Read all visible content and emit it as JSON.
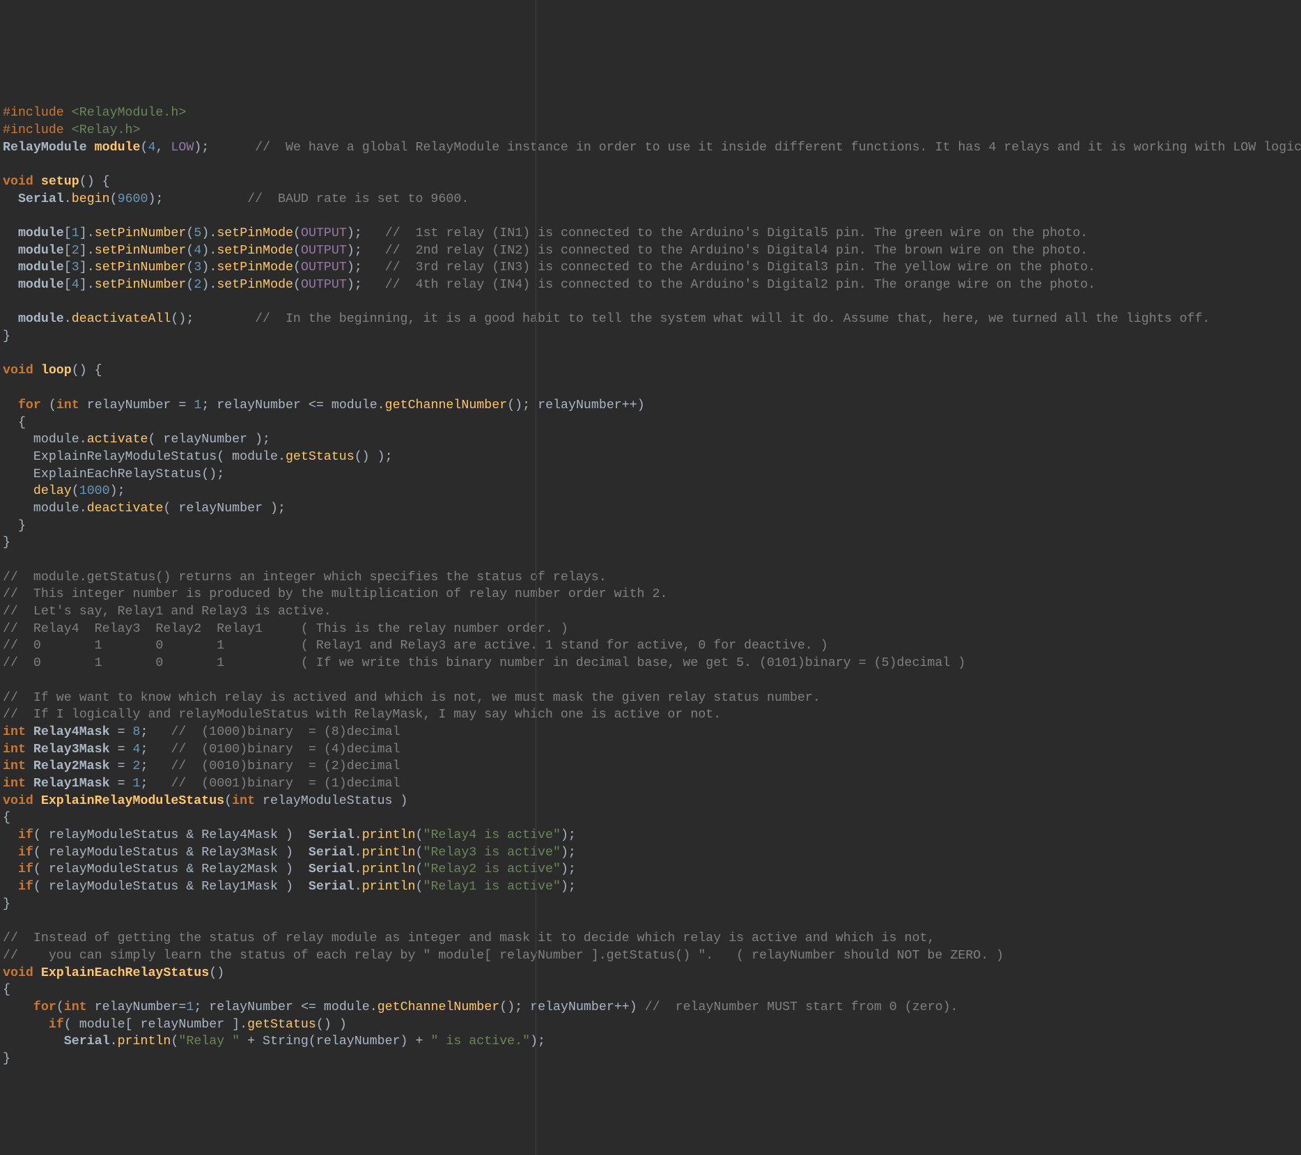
{
  "include1_kw": "#include ",
  "include1_hdr": "<RelayModule.h>",
  "include2_kw": "#include ",
  "include2_hdr": "<Relay.h>",
  "l3_type": "RelayModule ",
  "l3_var": "module",
  "l3_p1": "(",
  "l3_num1": "4",
  "l3_p2": ", ",
  "l3_const": "LOW",
  "l3_p3": ");",
  "l3_pad": "      ",
  "l3_cmt": "//  We have a global RelayModule instance in order to use it inside different functions. It has 4 relays and it is working with LOW logic.",
  "blank": " ",
  "setup_kw1": "void ",
  "setup_name": "setup",
  "setup_p": "() {",
  "ser_indent": "  ",
  "ser_obj": "Serial",
  "ser_dot": ".",
  "ser_fn": "begin",
  "ser_p1": "(",
  "ser_num": "9600",
  "ser_p2": ");",
  "ser_pad": "           ",
  "ser_cmt": "//  BAUD rate is set to 9600.",
  "pin_indent": "  ",
  "pin_obj": "module",
  "pin_lb": "[",
  "pin_rb": "]",
  "pin_dot": ".",
  "pin_fn1": "setPinNumber",
  "pin_fn2": "setPinMode",
  "pin_po": "(",
  "pin_pc": ")",
  "pin_sc": ";",
  "pin_out": "OUTPUT",
  "pin_pad": "   ",
  "pin1_idx": "1",
  "pin1_arg": "5",
  "pin1_cmt": "//  1st relay (IN1) is connected to the Arduino's Digital5 pin. The green wire on the photo.",
  "pin2_idx": "2",
  "pin2_arg": "4",
  "pin2_cmt": "//  2nd relay (IN2) is connected to the Arduino's Digital4 pin. The brown wire on the photo.",
  "pin3_idx": "3",
  "pin3_arg": "3",
  "pin3_cmt": "//  3rd relay (IN3) is connected to the Arduino's Digital3 pin. The yellow wire on the photo.",
  "pin4_idx": "4",
  "pin4_arg": "2",
  "pin4_cmt": "//  4th relay (IN4) is connected to the Arduino's Digital2 pin. The orange wire on the photo.",
  "deact_indent": "  ",
  "deact_obj": "module",
  "deact_dot": ".",
  "deact_fn": "deactivateAll",
  "deact_p": "();",
  "deact_pad": "        ",
  "deact_cmt": "//  In the beginning, it is a good habit to tell the system what will it do. Assume that, here, we turned all the lights off.",
  "cb": "}",
  "loop_kw": "void ",
  "loop_name": "loop",
  "loop_p": "() {",
  "for_indent": "  ",
  "for_kw": "for ",
  "for_po": "(",
  "for_int": "int ",
  "for_var": "relayNumber",
  "for_eq": " = ",
  "for_init": "1",
  "for_sc": "; ",
  "for_cond_v": "relayNumber",
  "for_cond_op": " <= ",
  "for_cond_obj": "module",
  "for_cond_dot": ".",
  "for_cond_fn": "getChannelNumber",
  "for_cond_p": "()",
  "for_sc2": "; ",
  "for_inc_v": "relayNumber",
  "for_inc_op": "++",
  "for_pc": ")",
  "ob": "  {",
  "b1_ind": "    ",
  "b1_obj": "module",
  "b1_dot": ".",
  "b1_fn": "activate",
  "b1_po": "( ",
  "b1_arg": "relayNumber",
  "b1_pc": " );",
  "b2_ind": "    ",
  "b2_fn": "ExplainRelayModuleStatus",
  "b2_po": "( ",
  "b2_obj": "module",
  "b2_dot": ".",
  "b2_fn2": "getStatus",
  "b2_p": "()",
  "b2_pc": " );",
  "b3_ind": "    ",
  "b3_fn": "ExplainEachRelayStatus",
  "b3_p": "();",
  "b4_ind": "    ",
  "b4_fn": "delay",
  "b4_po": "(",
  "b4_num": "1000",
  "b4_pc": ");",
  "b5_ind": "    ",
  "b5_obj": "module",
  "b5_dot": ".",
  "b5_fn": "deactivate",
  "b5_po": "( ",
  "b5_arg": "relayNumber",
  "b5_pc": " );",
  "cb2": "  }",
  "cblk1": "//  module.getStatus() returns an integer which specifies the status of relays.",
  "cblk2": "//  This integer number is produced by the multiplication of relay number order with 2.",
  "cblk3": "//  Let's say, Relay1 and Relay3 is active.",
  "cblk4": "//  Relay4  Relay3  Relay2  Relay1     ( This is the relay number order. )",
  "cblk5": "//  0       1       0       1          ( Relay1 and Relay3 are active. 1 stand for active, 0 for deactive. )",
  "cblk6": "//  0       1       0       1          ( If we write this binary number in decimal base, we get 5. (0101)binary = (5)decimal )",
  "cblk7": "//  If we want to know which relay is actived and which is not, we must mask the given relay status number.",
  "cblk8": "//  If I logically and relayModuleStatus with RelayMask, I may say which one is active or not.",
  "m_int": "int ",
  "m_eq": " = ",
  "m_sc": ";",
  "m_pad": "   ",
  "m4_name": "Relay4Mask",
  "m4_val": "8",
  "m4_cmt": "//  (1000)binary  = (8)decimal",
  "m3_name": "Relay3Mask",
  "m3_val": "4",
  "m3_cmt": "//  (0100)binary  = (4)decimal",
  "m2_name": "Relay2Mask",
  "m2_val": "2",
  "m2_cmt": "//  (0010)binary  = (2)decimal",
  "m1_name": "Relay1Mask",
  "m1_val": "1",
  "m1_cmt": "//  (0001)binary  = (1)decimal",
  "fndecl1_kw": "void ",
  "fndecl1_name": "ExplainRelayModuleStatus",
  "fndecl1_po": "(",
  "fndecl1_argt": "int ",
  "fndecl1_argn": "relayModuleStatus",
  "fndecl1_pc": " )",
  "ob2": "{",
  "if_kw": "  if",
  "if_po": "( ",
  "if_arg1": "relayModuleStatus",
  "if_amp": " & ",
  "if_pc": " )  ",
  "if_ser": "Serial",
  "if_dot": ".",
  "if_fn": "println",
  "if_ppo": "(",
  "if_ppc": ");",
  "if_str4": "\"Relay4 is active\"",
  "if_str3": "\"Relay3 is active\"",
  "if_str2": "\"Relay2 is active\"",
  "if_str1": "\"Relay1 is active\"",
  "cblk9": "//  Instead of getting the status of relay module as integer and mask it to decide which relay is active and which is not,",
  "cblk10": "//    you can simply learn the status of each relay by \" module[ relayNumber ].getStatus() \".   ( relayNumber should NOT be ZERO. )",
  "fndecl2_kw": "void ",
  "fndecl2_name": "ExplainEachRelayStatus",
  "fndecl2_p": "()",
  "for2_ind": "    ",
  "for2_kw": "for",
  "for2_po": "(",
  "for2_int": "int ",
  "for2_var": "relayNumber",
  "for2_eq": "=",
  "for2_init": "1",
  "for2_sc": "; ",
  "for2_cond_v": "relayNumber",
  "for2_cond_op": " <= ",
  "for2_cond_obj": "module",
  "for2_cond_dot": ".",
  "for2_cond_fn": "getChannelNumber",
  "for2_cond_p": "()",
  "for2_sc2": "; ",
  "for2_inc_v": "relayNumber",
  "for2_inc_op": "++",
  "for2_pc": ") ",
  "for2_cmt": "//  relayNumber MUST start from 0 (zero).",
  "inn_if_ind": "      ",
  "inn_if_kw": "if",
  "inn_if_po": "( ",
  "inn_if_obj": "module",
  "inn_if_lb": "[ ",
  "inn_if_var": "relayNumber",
  "inn_if_rb": " ]",
  "inn_if_dot": ".",
  "inn_if_fn": "getStatus",
  "inn_if_p": "()",
  "inn_if_pc": " )",
  "pr_ind": "        ",
  "pr_obj": "Serial",
  "pr_dot": ".",
  "pr_fn": "println",
  "pr_po": "(",
  "pr_str1": "\"Relay \"",
  "pr_plus": " + ",
  "pr_strfn": "String",
  "pr_ppo": "(",
  "pr_var": "relayNumber",
  "pr_ppc": ")",
  "pr_plus2": " + ",
  "pr_str2": "\" is active.\"",
  "pr_pc": ");"
}
